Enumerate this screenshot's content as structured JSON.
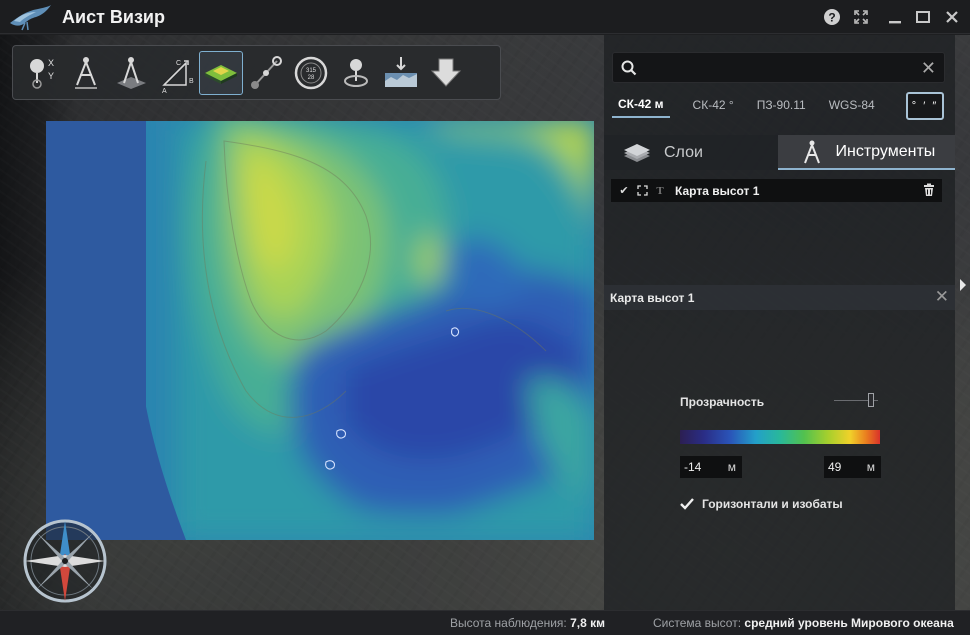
{
  "app": {
    "title": "Аист Визир"
  },
  "window_controls": {
    "help": "?",
    "fullscreen": "fullscreen-icon",
    "minimize": "minimize-icon",
    "maximize": "maximize-icon",
    "close": "close-icon"
  },
  "toolbar": {
    "tools": [
      {
        "name": "coordinates-xy-tool",
        "icon": "pin-xy-icon",
        "active": false
      },
      {
        "name": "distance-tool",
        "icon": "compass-divider-icon",
        "active": false
      },
      {
        "name": "area-tool",
        "icon": "area-divider-icon",
        "active": false
      },
      {
        "name": "triangle-tool",
        "icon": "triangle-abc-icon",
        "active": false
      },
      {
        "name": "height-map-tool",
        "icon": "terrain-layer-icon",
        "active": true
      },
      {
        "name": "line-of-sight-tool",
        "icon": "line-of-sight-icon",
        "active": false
      },
      {
        "name": "azimuth-tool",
        "icon": "azimuth-dial-icon",
        "active": false
      },
      {
        "name": "orbit-tool",
        "icon": "orbit-pin-icon",
        "active": false
      },
      {
        "name": "profile-tool",
        "icon": "terrain-profile-icon",
        "active": false
      },
      {
        "name": "export-tool",
        "icon": "download-arrow-icon",
        "active": false
      }
    ],
    "azimuth_dial_text": [
      "315",
      "28"
    ],
    "xy_label": [
      "X",
      "Y"
    ],
    "abc_label": [
      "A",
      "C",
      "B"
    ]
  },
  "search": {
    "value": "",
    "placeholder": ""
  },
  "coord_systems": {
    "tabs": [
      "СК-42 м",
      "СК-42 °",
      "ПЗ-90.11",
      "WGS-84"
    ],
    "active_index": 0,
    "dms_button": "° ′ ″"
  },
  "main_tabs": {
    "layers": "Слои",
    "tools": "Инструменты",
    "active": "tools"
  },
  "layers_list": [
    {
      "name": "Карта высот 1",
      "visible": true
    }
  ],
  "properties": {
    "title": "Карта высот 1",
    "transparency_label": "Прозрачность",
    "transparency_value": 0.9,
    "min_value": "-14",
    "max_value": "49",
    "unit": "м",
    "contours_label": "Горизонтали и изобаты",
    "contours_checked": true
  },
  "status": {
    "altitude_label": "Высота наблюдения:",
    "altitude_value": "7,8 км",
    "height_system_label": "Система высот:",
    "height_system_value": "средний уровень Мирового океана"
  },
  "colors": {
    "accent": "#8fb4cf",
    "panel_bg": "#1c1e21",
    "colormap": [
      "#2c1f52",
      "#2a2d86",
      "#2a54b8",
      "#23a0c9",
      "#29b89a",
      "#52c14f",
      "#a6cf2d",
      "#f0d12a",
      "#ea7f1f",
      "#d9322a"
    ]
  }
}
